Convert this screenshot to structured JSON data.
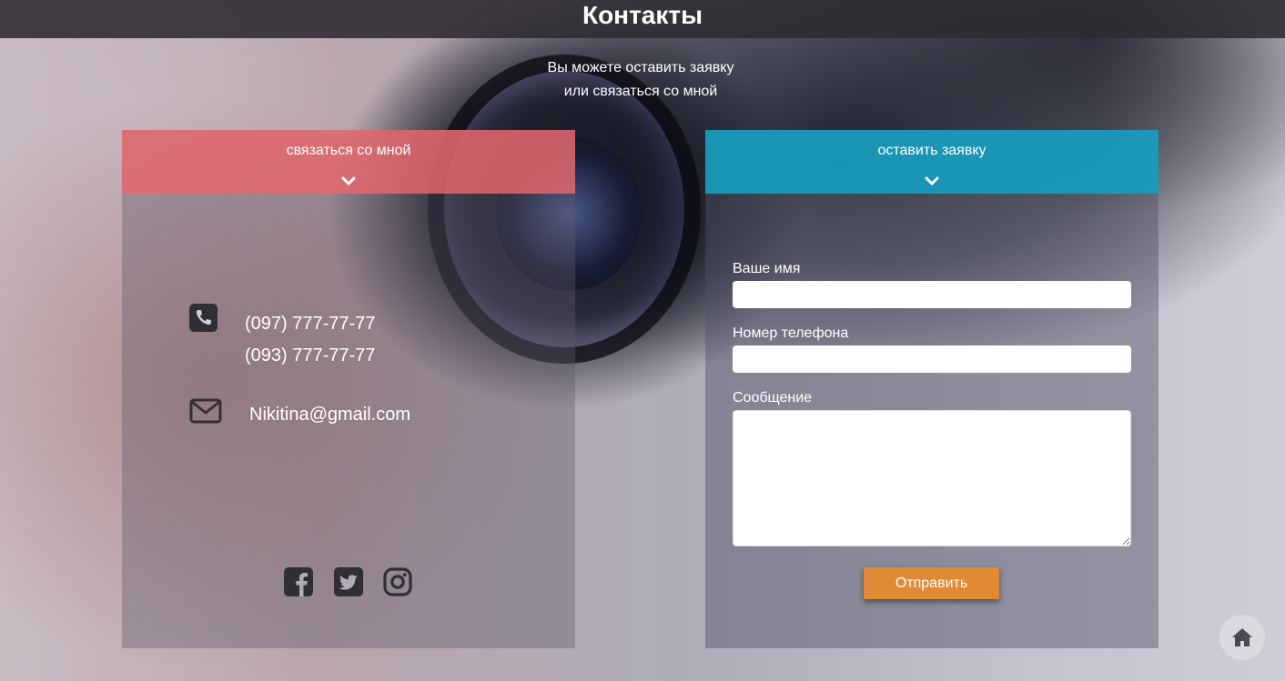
{
  "header": {
    "title": "Контакты"
  },
  "intro": {
    "line1": "Вы можете оставить заявку",
    "line2": "или связаться со мной"
  },
  "contact_panel": {
    "title": "связаться со мной",
    "accent": "#e8686c",
    "phones": [
      "(097) 777-77-77",
      "(093) 777-77-77"
    ],
    "email": "Nikitina@gmail.com",
    "icons": [
      "phone-icon",
      "envelope-icon",
      "facebook-icon",
      "twitter-icon",
      "instagram-icon"
    ]
  },
  "form_panel": {
    "title": "оставить заявку",
    "accent": "#16a0c4",
    "fields": {
      "name_label": "Ваше имя",
      "name_value": "",
      "phone_label": "Номер телефона",
      "phone_value": "",
      "message_label": "Сообщение",
      "message_value": ""
    },
    "submit_label": "Отправить",
    "submit_color": "#e08a35"
  },
  "home_button": {
    "icon": "home-icon"
  }
}
